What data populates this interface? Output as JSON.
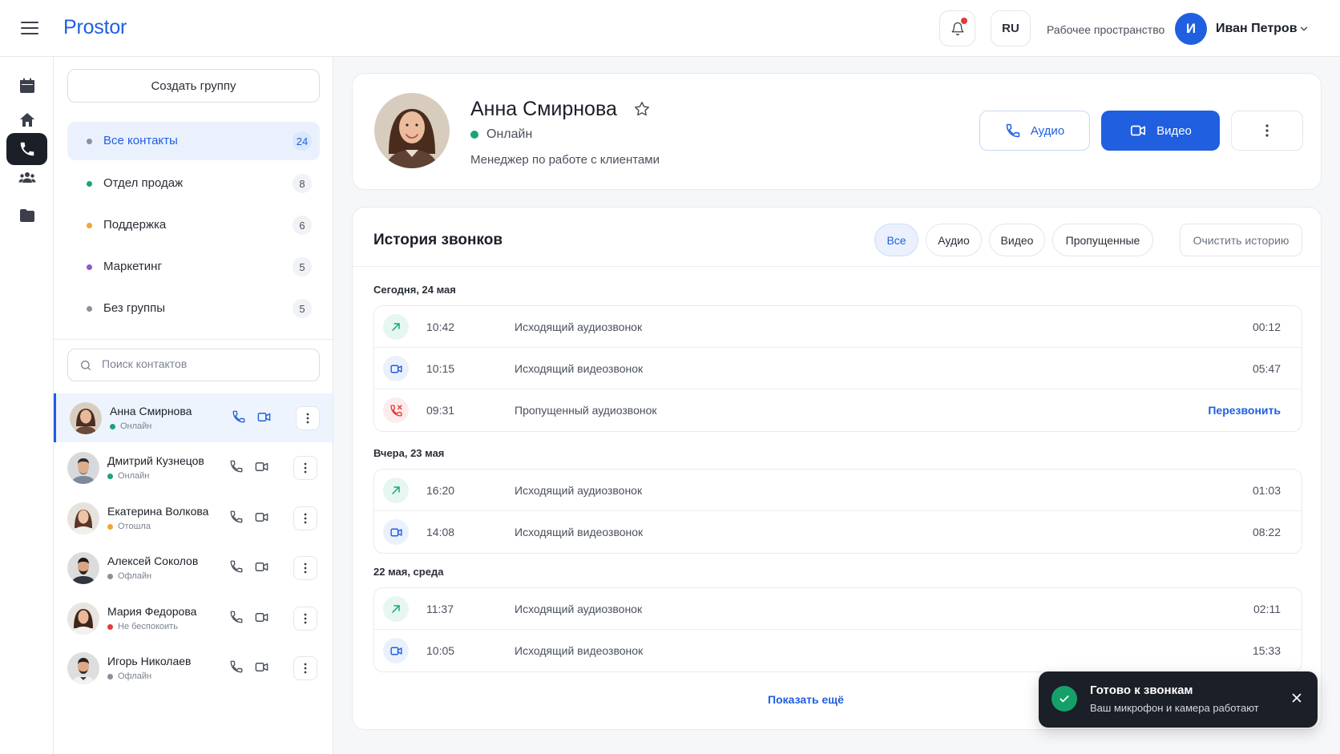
{
  "app": {
    "brand": "Prostor",
    "lang": "RU",
    "workspace": "Рабочее пространство",
    "user": {
      "initial": "И",
      "name": "Иван Петров"
    }
  },
  "rail": [
    "calendar-icon",
    "home-icon",
    "phone-icon",
    "users-icon",
    "folder-icon"
  ],
  "contacts_panel": {
    "create_group": "Создать группу",
    "groups": [
      {
        "label": "Все контакты",
        "count": "24",
        "color": "#8a909c"
      },
      {
        "label": "Отдел продаж",
        "count": "8",
        "color": "#1aa37a"
      },
      {
        "label": "Поддержка",
        "count": "6",
        "color": "#f2a533"
      },
      {
        "label": "Маркетинг",
        "count": "5",
        "color": "#8e57d6"
      },
      {
        "label": "Без группы",
        "count": "5",
        "color": "#8a909c"
      }
    ],
    "search_placeholder": "Поиск контактов",
    "contacts": [
      {
        "name": "Анна Смирнова",
        "status": "Онлайн",
        "status_color": "#1aa37a"
      },
      {
        "name": "Дмитрий Кузнецов",
        "status": "Онлайн",
        "status_color": "#1aa37a"
      },
      {
        "name": "Екатерина Волкова",
        "status": "Отошла",
        "status_color": "#f2a533"
      },
      {
        "name": "Алексей Соколов",
        "status": "Офлайн",
        "status_color": "#8a909c"
      },
      {
        "name": "Мария Федорова",
        "status": "Не беспокоить",
        "status_color": "#e53935"
      },
      {
        "name": "Игорь Николаев",
        "status": "Офлайн",
        "status_color": "#8a909c"
      }
    ]
  },
  "profile": {
    "name": "Анна Смирнова",
    "status": "Онлайн",
    "role": "Менеджер по работе с клиентами",
    "audio_label": "Аудио",
    "video_label": "Видео"
  },
  "history": {
    "title": "История звонков",
    "filters": [
      "Все",
      "Аудио",
      "Видео",
      "Пропущенные"
    ],
    "clear_label": "Очистить историю",
    "days": [
      {
        "label": "Сегодня, 24 мая",
        "calls": [
          {
            "kind": "audio-out",
            "time": "10:42",
            "type": "Исходящий аудиозвонок",
            "duration": "00:12"
          },
          {
            "kind": "video",
            "time": "10:15",
            "type": "Исходящий видеозвонок",
            "duration": "05:47"
          },
          {
            "kind": "missed",
            "time": "09:31",
            "type": "Пропущенный аудиозвонок",
            "action": "Перезвонить"
          }
        ]
      },
      {
        "label": "Вчера, 23 мая",
        "calls": [
          {
            "kind": "audio-out",
            "time": "16:20",
            "type": "Исходящий аудиозвонок",
            "duration": "01:03"
          },
          {
            "kind": "video",
            "time": "14:08",
            "type": "Исходящий видеозвонок",
            "duration": "08:22"
          }
        ]
      },
      {
        "label": "22 мая, среда",
        "calls": [
          {
            "kind": "audio-out",
            "time": "11:37",
            "type": "Исходящий аудиозвонок",
            "duration": "02:11"
          },
          {
            "kind": "video",
            "time": "10:05",
            "type": "Исходящий видеозвонок",
            "duration": "15:33"
          }
        ]
      }
    ],
    "show_more": "Показать ещё"
  },
  "toast": {
    "title": "Готово к звонкам",
    "text": "Ваш микрофон и камера работают"
  },
  "colors": {
    "accent": "#1f5fe0",
    "online": "#1aa37a",
    "missed": "#e53935"
  }
}
